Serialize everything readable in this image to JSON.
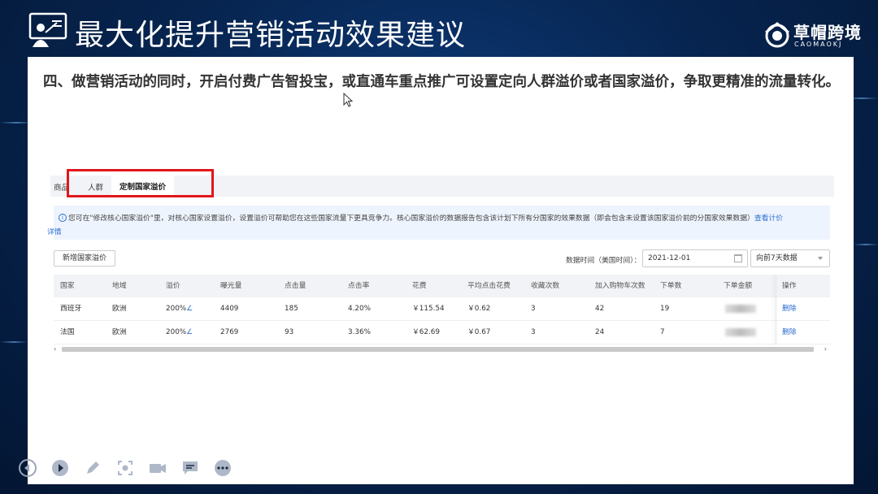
{
  "slide": {
    "title": "最大化提升营销活动效果建议",
    "logo_cn": "草帽跨境",
    "logo_en": "CAOMAOKJ",
    "heading": "四、做营销活动的同时，开启付费广告智投宝，或直通车重点推广可设置定向人群溢价或者国家溢价，争取更精准的流量转化。"
  },
  "tabs": {
    "items": [
      "商品",
      "人群",
      "定制国家溢价"
    ],
    "active": "定制国家溢价"
  },
  "info": {
    "text": "您可在\"修改核心国家溢价\"里，对核心国家设置溢价，设置溢价可帮助您在这些国家流量下更具竞争力。核心国家溢价的数据报告包含该计划下所有分国家的效果数据（即会包含未设置该国家溢价前的分国家效果数据）",
    "link1": "查看计价",
    "link2": "详情"
  },
  "controls": {
    "add_button": "新增国家溢价",
    "date_label": "数据时间（美国时间）：",
    "date_value": "2021-12-01",
    "range_value": "向前7天数据"
  },
  "table": {
    "columns": [
      "国家",
      "地域",
      "溢价",
      "曝光量",
      "点击量",
      "点击率",
      "花费",
      "平均点击花费",
      "收藏次数",
      "加入购物车次数",
      "下单数",
      "下单金额",
      "操作"
    ],
    "rows": [
      {
        "country": "西班牙",
        "region": "欧洲",
        "premium": "200%",
        "impressions": "4409",
        "clicks": "185",
        "ctr": "4.20%",
        "cost": "￥115.54",
        "avg_cpc": "￥0.62",
        "favorites": "3",
        "cart_adds": "42",
        "orders": "19",
        "action": "删除"
      },
      {
        "country": "法国",
        "region": "欧洲",
        "premium": "200%",
        "impressions": "2769",
        "clicks": "93",
        "ctr": "3.36%",
        "cost": "￥62.69",
        "avg_cpc": "￥0.67",
        "favorites": "3",
        "cart_adds": "24",
        "orders": "7",
        "action": "删除"
      }
    ]
  },
  "colors": {
    "highlight": "#e1161c",
    "link": "#2b6ed4",
    "background": "#072551"
  },
  "icons": [
    "presentation-icon",
    "brand-logo-icon",
    "cursor-icon",
    "info-icon",
    "calendar-icon",
    "chevron-down-icon",
    "edit-icon",
    "prev-icon",
    "play-icon",
    "pen-icon",
    "screenshot-icon",
    "camera-icon",
    "comment-icon",
    "more-icon"
  ]
}
